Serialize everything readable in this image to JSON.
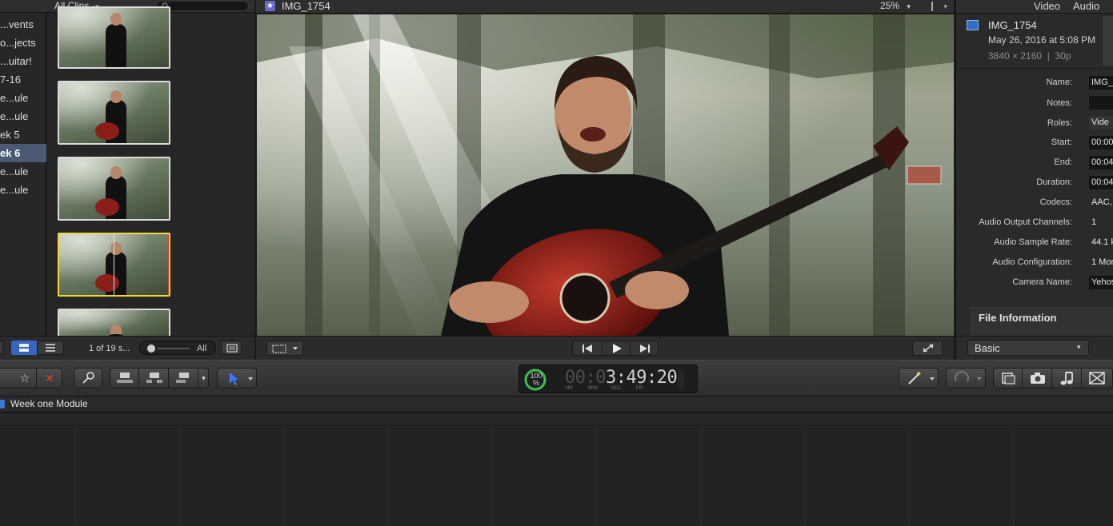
{
  "libraries": {
    "items": [
      {
        "label": "...vents"
      },
      {
        "label": "o...jects"
      },
      {
        "label": "...uitar!"
      },
      {
        "label": "7-16"
      },
      {
        "label": "e...ule"
      },
      {
        "label": "e...ule"
      },
      {
        "label": "ek 5"
      },
      {
        "label": "ek 6"
      },
      {
        "label": "e...ule"
      },
      {
        "label": "e...ule"
      }
    ],
    "selected_index": 7
  },
  "browser": {
    "filter_label": "All Clips",
    "search_placeholder": "",
    "clip_count": "1 of 19 s...",
    "duration_filter": "All"
  },
  "viewer": {
    "clip_name": "IMG_1754",
    "zoom": "25%"
  },
  "inspector": {
    "tabs": [
      "Video",
      "Audio"
    ],
    "clip_name": "IMG_1754",
    "date": "May 26, 2016 at 5:08 PM",
    "format": "3840 × 2160  |  30p",
    "fields": [
      {
        "label": "Name:",
        "value": "IMG_"
      },
      {
        "label": "Notes:",
        "value": ""
      },
      {
        "label": "Roles:",
        "value": "Vide"
      },
      {
        "label": "Start:",
        "value": "00:00"
      },
      {
        "label": "End:",
        "value": "00:04"
      },
      {
        "label": "Duration:",
        "value": "00:04"
      },
      {
        "label": "Codecs:",
        "value": "AAC,"
      },
      {
        "label": "Audio Output Channels:",
        "value": "1"
      },
      {
        "label": "Audio Sample Rate:",
        "value": "44.1 k"
      },
      {
        "label": "Audio Configuration:",
        "value": "1 Mor"
      },
      {
        "label": "Camera Name:",
        "value": "Yehos"
      }
    ],
    "section": "File Information",
    "metadata_view": "Basic"
  },
  "toolbar": {
    "progress": "100",
    "progress_unit": "%",
    "timecode": "00:03:49:20",
    "timecode_dim": "00:0",
    "timecode_bright": "3:49:20",
    "tc_labels": [
      "HR",
      "MIN",
      "SEC",
      "FR"
    ]
  },
  "timeline": {
    "project_name": "Week one Module"
  },
  "colors": {
    "selection_yellow": "#f1d63c",
    "accent_blue": "#3a6fd8",
    "reject_red": "#d73a2c",
    "progress_green": "#3fbf4f"
  }
}
